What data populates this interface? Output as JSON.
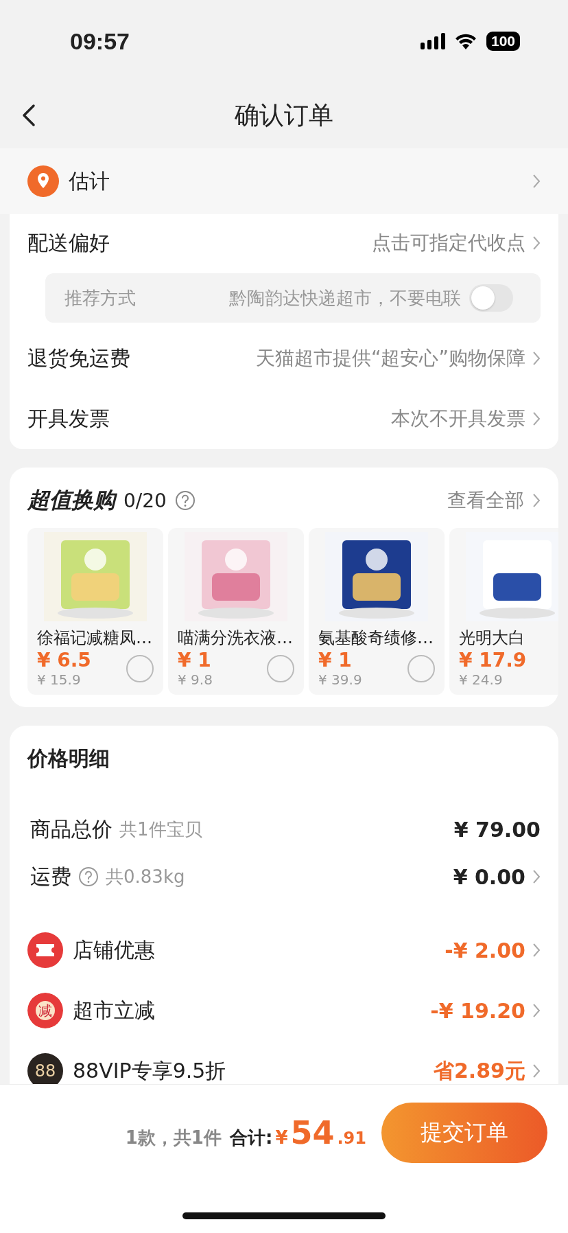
{
  "status_bar": {
    "time": "09:57",
    "battery": "100"
  },
  "nav": {
    "title": "确认订单"
  },
  "address": {
    "label": "估计"
  },
  "delivery": [
    {
      "kind": "link",
      "label": "配送偏好",
      "value": "点击可指定代收点"
    },
    {
      "kind": "recommend",
      "label": "推荐方式",
      "value": "黔陶韵达快递超市，不要电联",
      "on": false
    },
    {
      "kind": "link",
      "label": "退货免运费",
      "value": "天猫超市提供“超安心”购物保障"
    },
    {
      "kind": "link",
      "label": "开具发票",
      "value": "本次不开具发票"
    }
  ],
  "exchange": {
    "title": "超值换购",
    "count": "0/20",
    "more": "查看全部",
    "items": [
      {
        "name": "徐福记减糖凤…",
        "price": "¥ 6.5",
        "old_price": "¥ 15.9",
        "selected": false
      },
      {
        "name": "喵满分洗衣液…",
        "price": "¥ 1",
        "old_price": "¥ 9.8",
        "selected": false
      },
      {
        "name": "氨基酸奇绩修…",
        "price": "¥ 1",
        "old_price": "¥ 39.9",
        "selected": false
      },
      {
        "name": "光明大白",
        "price": "¥ 17.9",
        "old_price": "¥ 24.9"
      }
    ]
  },
  "price_detail": {
    "title": "价格明细",
    "rows": [
      {
        "kind": "total",
        "label": "商品总价",
        "note": "共1件宝贝",
        "value": "¥ 79.00"
      },
      {
        "kind": "shipping",
        "label": "运费",
        "note": "共0.83kg",
        "value": "¥ 0.00"
      },
      {
        "kind": "coupon",
        "label": "店铺优惠",
        "value": "-¥ 2.00"
      },
      {
        "kind": "reduce",
        "badge": "减",
        "label": "超市立减",
        "value": "-¥ 19.20"
      },
      {
        "kind": "vip",
        "badge": "88",
        "label": "88VIP专享9.5折",
        "value": "省2.89元"
      }
    ]
  },
  "footer": {
    "count": "1款，共1件",
    "total_label": "合计:",
    "currency": "¥",
    "integer": "54",
    "decimal": ".91",
    "submit": "提交订单"
  }
}
